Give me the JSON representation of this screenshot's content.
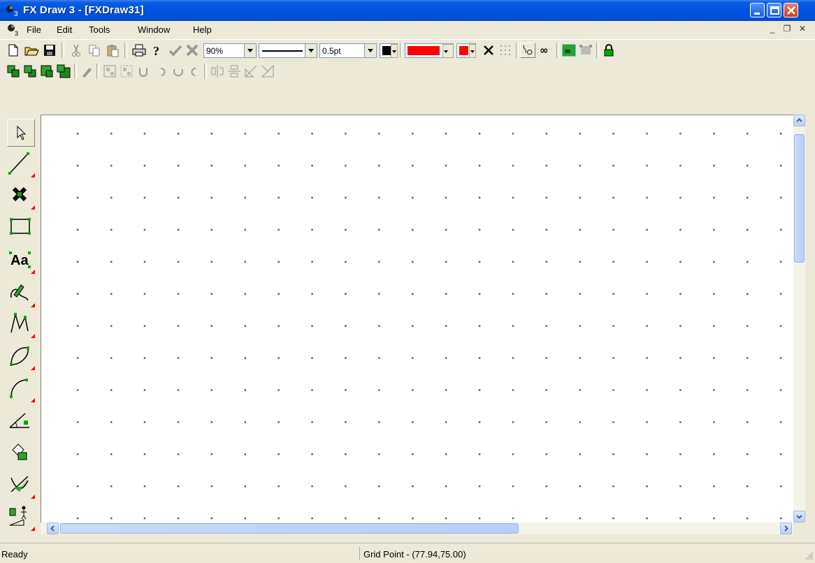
{
  "window": {
    "title": "FX Draw 3 - [FXDraw31]",
    "accent": "#0054e3"
  },
  "menu": {
    "items": [
      "File",
      "Edit",
      "Tools",
      "Window",
      "Help"
    ]
  },
  "toolbar": {
    "zoom": "90%",
    "line_width": "0.5pt",
    "line_color": "#000000",
    "fill_color": "#ff0000",
    "point_color": "#ff0000"
  },
  "tools": [
    "select-tool",
    "line-tool",
    "point-tool",
    "rectangle-tool",
    "text-tool",
    "freehand-tool",
    "polyline-tool",
    "curve-tool",
    "arc-tool",
    "angle-tool",
    "fill-tool",
    "graph-tool",
    "shapes-tool"
  ],
  "canvas": {
    "background": "#ffffff",
    "grid_dots": true
  },
  "status": {
    "left": "Ready",
    "center": "Grid Point - (77.94,75.00)"
  }
}
